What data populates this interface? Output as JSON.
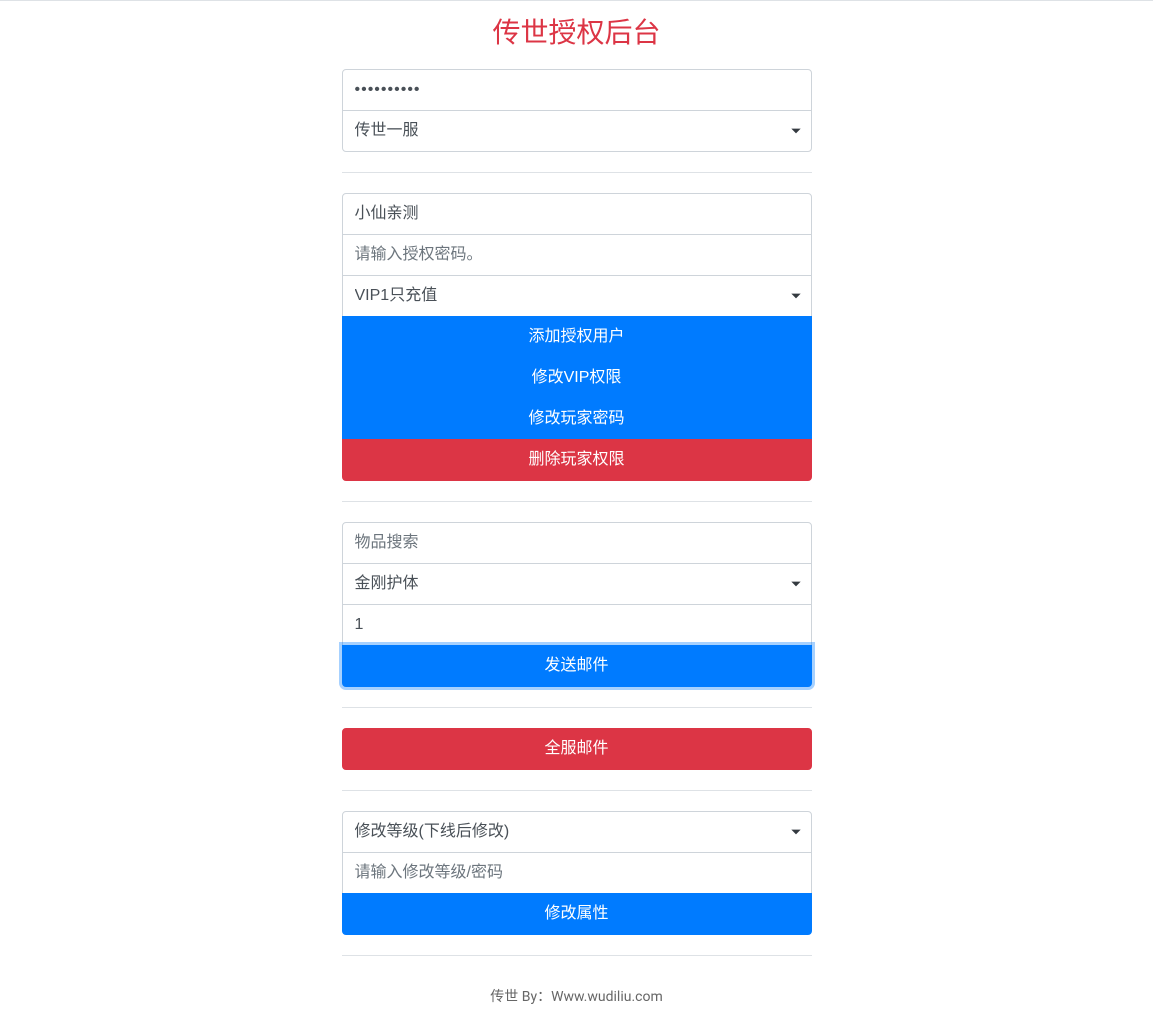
{
  "header": {
    "title": "传世授权后台"
  },
  "section1": {
    "password_value": "••••••••••",
    "server_select": "传世一服"
  },
  "section2": {
    "username_value": "小仙亲测",
    "auth_password_placeholder": "请输入授权密码。",
    "vip_select": "VIP1只充值",
    "btn_add_user": "添加授权用户",
    "btn_modify_vip": "修改VIP权限",
    "btn_modify_player_password": "修改玩家密码",
    "btn_delete_player": "删除玩家权限"
  },
  "section3": {
    "item_search_placeholder": "物品搜索",
    "item_select": "金刚护体",
    "quantity_value": "1",
    "btn_send_mail": "发送邮件"
  },
  "section4": {
    "btn_server_mail": "全服邮件"
  },
  "section5": {
    "modify_select": "修改等级(下线后修改)",
    "modify_input_placeholder": "请输入修改等级/密码",
    "btn_modify_attr": "修改属性"
  },
  "footer": {
    "text": "传世 By：Www.wudiliu.com"
  }
}
